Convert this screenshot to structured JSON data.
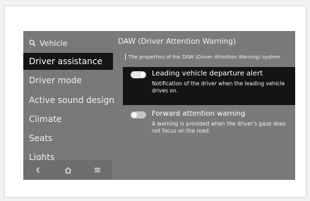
{
  "sidebar": {
    "search_label": "Vehicle",
    "items": [
      {
        "label": "Driver assistance",
        "selected": true
      },
      {
        "label": "Driver mode",
        "selected": false
      },
      {
        "label": "Active sound design",
        "selected": false
      },
      {
        "label": "Climate",
        "selected": false
      },
      {
        "label": "Seats",
        "selected": false
      },
      {
        "label": "Lights",
        "selected": false
      }
    ],
    "bottom_icons": [
      "back-icon",
      "home-icon",
      "menu-icon"
    ]
  },
  "panel": {
    "title": "DAW (Driver Attention Warning)",
    "description": "The properties of the DAW (Driver Attention Warning) system",
    "options": [
      {
        "title": "Leading vehicle departure alert",
        "description": "Notification of the driver when the leading vehicle drives on.",
        "enabled": true,
        "highlighted": true
      },
      {
        "title": "Forward attention warning",
        "description": "A warning is provided when the driver's gaze does not focus on the road.",
        "enabled": false,
        "highlighted": false
      }
    ]
  },
  "colors": {
    "screen_bg": "#7a7a7a",
    "selected_bg": "#151515",
    "text": "#f2f2f2"
  }
}
